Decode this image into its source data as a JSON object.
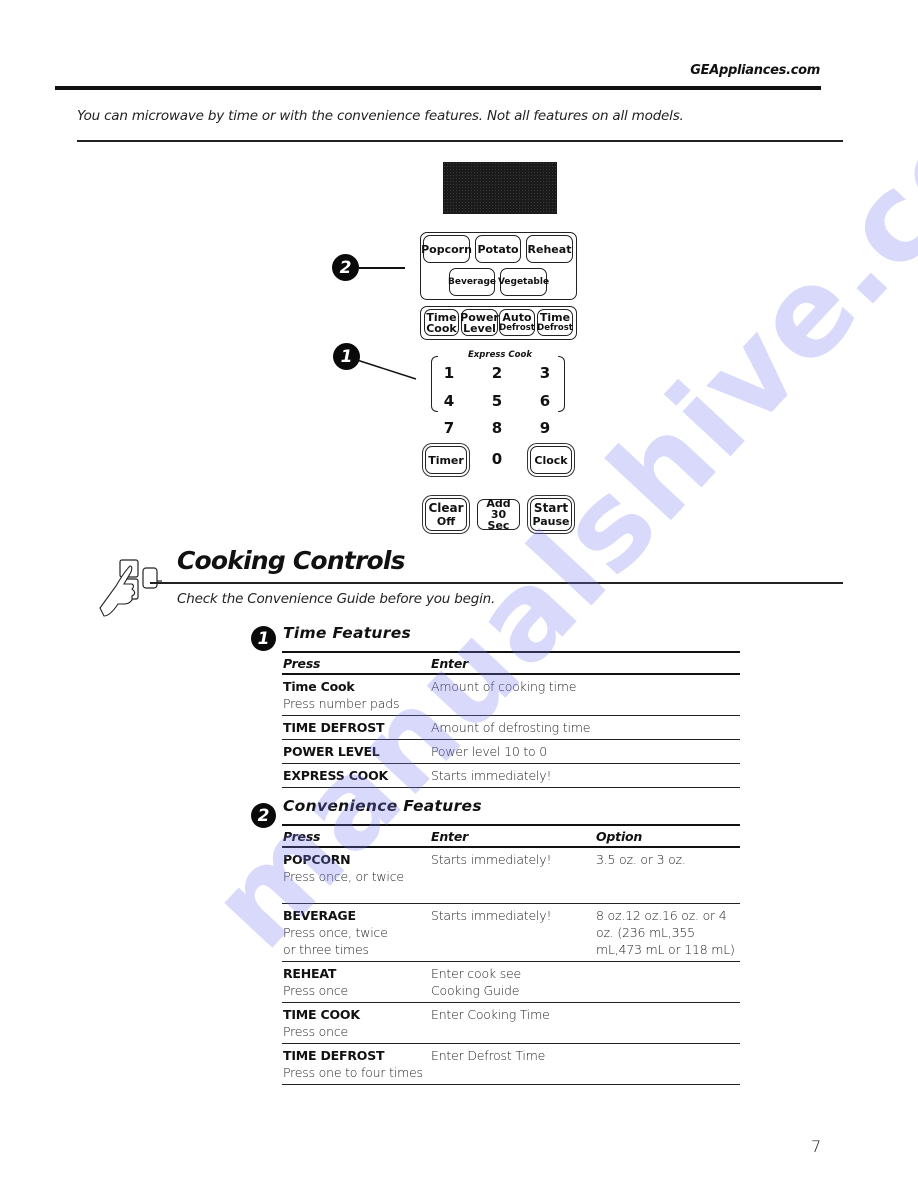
{
  "header": {
    "site": "GEAppliances.com",
    "intro": "You can microwave by time or with the convenience features.  Not all features on all models."
  },
  "panel": {
    "callouts": {
      "convenience": "2",
      "time": "1"
    },
    "row1": [
      "Popcorn",
      "Potato",
      "Reheat"
    ],
    "row2": [
      "Beverage",
      "Vegetable"
    ],
    "row3": [
      {
        "line1": "Time",
        "line2": "Cook"
      },
      {
        "line1": "Power",
        "line2": "Level"
      },
      {
        "line1": "Auto",
        "line2": "Defrost"
      },
      {
        "line1": "Time",
        "line2": "Defrost"
      }
    ],
    "express_label": "Express Cook",
    "digits": [
      "1",
      "2",
      "3",
      "4",
      "5",
      "6",
      "7",
      "8",
      "9",
      "0"
    ],
    "timer": "Timer",
    "clock": "Clock",
    "clear": {
      "line1": "Clear",
      "line2": "Off"
    },
    "add30": {
      "line1": "Add",
      "line2": "30 Sec"
    },
    "start": {
      "line1": "Start",
      "line2": "Pause"
    }
  },
  "section": {
    "title": "Cooking Controls",
    "subtitle": "Check the Convenience Guide before you begin.",
    "icon": "hand-pressing-button-icon"
  },
  "time_features": {
    "badge": "1",
    "title": "Time Features",
    "headers": [
      "Press",
      "Enter"
    ],
    "rows": [
      {
        "press": "Time Cook",
        "press_note": "Press number pads",
        "enter": "Amount of cooking time"
      },
      {
        "press": "TIME DEFROST",
        "press_note": "",
        "enter": "Amount of defrosting time"
      },
      {
        "press": "POWER LEVEL",
        "press_note": "",
        "enter": "Power level 10 to 0"
      },
      {
        "press": "EXPRESS COOK",
        "press_note": "",
        "enter": "Starts immediately!"
      }
    ]
  },
  "convenience_features": {
    "badge": "2",
    "title": "Convenience Features",
    "headers": [
      "Press",
      "Enter",
      "Option"
    ],
    "rows": [
      {
        "press": "POPCORN",
        "press_note": "Press once, or twice",
        "enter": "Starts immediately!",
        "option": "3.5 oz. or 3 oz."
      },
      {
        "press": "BEVERAGE",
        "press_note": "Press once, twice or three times",
        "enter": "Starts immediately!",
        "option": "8 oz.12 oz.16 oz. or 4 oz. (236 mL,355 mL,473 mL or 118 mL)"
      },
      {
        "press": "REHEAT",
        "press_note": "Press once",
        "enter": "Enter cook see Cooking Guide",
        "option": ""
      },
      {
        "press": "TIME COOK",
        "press_note": "Press once",
        "enter": "Enter Cooking Time",
        "option": ""
      },
      {
        "press": "TIME DEFROST",
        "press_note": "Press one to four times",
        "enter": "Enter Defrost Time",
        "option": ""
      }
    ]
  },
  "footer": {
    "page_number": "7"
  },
  "watermark": "manualshive.com"
}
